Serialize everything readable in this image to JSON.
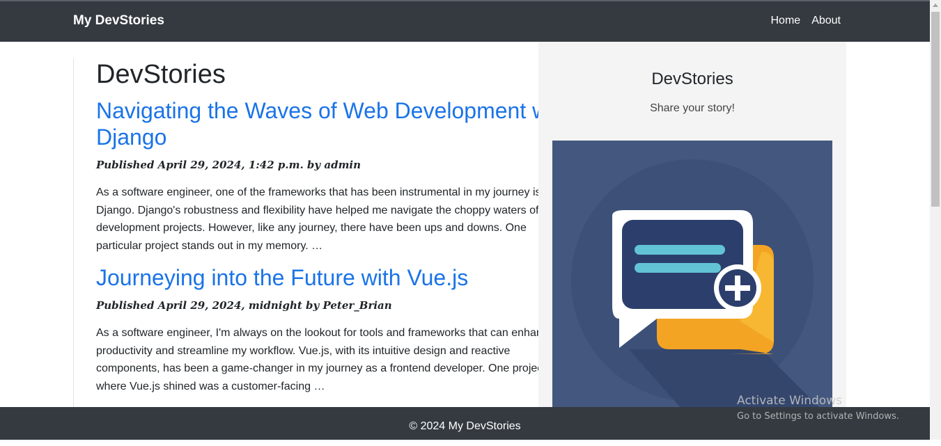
{
  "navbar": {
    "brand": "My DevStories",
    "links": [
      "Home",
      "About"
    ]
  },
  "main": {
    "heading": "DevStories",
    "posts": [
      {
        "title": "Navigating the Waves of Web Development with Django",
        "meta": "Published April 29, 2024, 1:42 p.m. by admin",
        "excerpt": "As a software engineer, one of the frameworks that has been instrumental in my journey is Django. Django's robustness and flexibility have helped me navigate the choppy waters of development projects. However, like any journey, there have been ups and downs. One particular project stands out in my memory. …"
      },
      {
        "title": "Journeying into the Future with Vue.js",
        "meta": "Published April 29, 2024, midnight by Peter_Brian",
        "excerpt": "As a software engineer, I'm always on the lookout for tools and frameworks that can enhance productivity and streamline my workflow. Vue.js, with its intuitive design and reactive components, has been a game-changer in my journey as a frontend developer. One project where Vue.js shined was a customer-facing …"
      }
    ]
  },
  "sidebar": {
    "title": "DevStories",
    "tagline": "Share your story!",
    "image_icon": "chat-bubble-plus-icon"
  },
  "footer": {
    "text": "© 2024 My DevStories"
  },
  "watermark": {
    "title": "Activate Windows",
    "subtitle": "Go to Settings to activate Windows."
  },
  "colors": {
    "navbar_bg": "#343a40",
    "link": "#1a73e8",
    "sidebar_bg": "#f4f4f4",
    "logo_bg": "#44587f"
  }
}
